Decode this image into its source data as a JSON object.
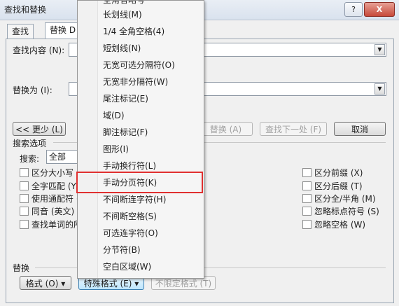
{
  "window": {
    "title": "查找和替换",
    "help": "?",
    "close": "X"
  },
  "tabs": {
    "find": "查找",
    "replace": "替换 D"
  },
  "find": {
    "label": "查找内容 (N):",
    "value": ""
  },
  "replace_with": {
    "label": "替换为 (I):",
    "value": ""
  },
  "buttons": {
    "less": "<< 更少 (L)",
    "replace": "替换 (A)",
    "find_next": "查找下一处 (F)",
    "cancel": "取消",
    "format": "格式 (O) ▾",
    "special": "特殊格式 (E) ▾",
    "no_format": "不限定格式 (T)"
  },
  "search_options": {
    "heading": "搜索选项",
    "search_label": "搜索:",
    "search_value": "全部",
    "left": [
      "区分大小写 (H)",
      "全字匹配 (Y)",
      "使用通配符 (U)",
      "同音 (英文) (K)",
      "查找单词的所有形式 (英文) (W)"
    ],
    "right": [
      "区分前缀 (X)",
      "区分后缀 (T)",
      "区分全/半角 (M)",
      "忽略标点符号 (S)",
      "忽略空格 (W)"
    ]
  },
  "replace_section": {
    "heading": "替换"
  },
  "menu_items": [
    "全角省略号",
    "长划线(M)",
    "1/4 全角空格(4)",
    "短划线(N)",
    "无宽可选分隔符(O)",
    "无宽非分隔符(W)",
    "尾注标记(E)",
    "域(D)",
    "脚注标记(F)",
    "图形(I)",
    "手动换行符(L)",
    "手动分页符(K)",
    "不间断连字符(H)",
    "不间断空格(S)",
    "可选连字符(O)",
    "分节符(B)",
    "空白区域(W)"
  ],
  "colors": {
    "highlight_border": "#e03030"
  }
}
